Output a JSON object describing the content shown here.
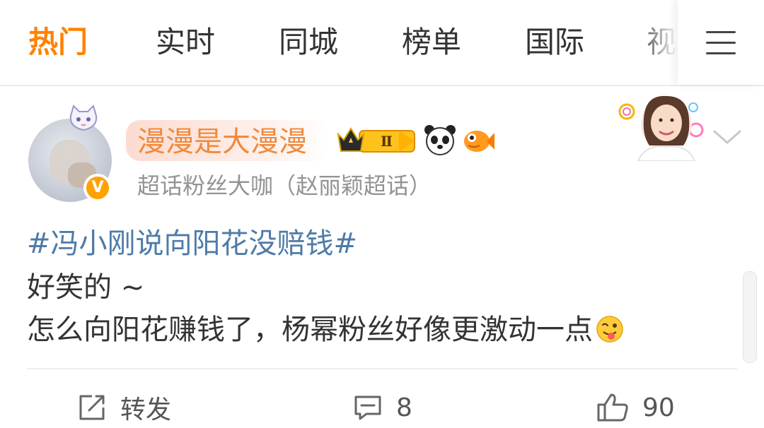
{
  "tabs": [
    {
      "label": "热门",
      "active": true
    },
    {
      "label": "实时",
      "active": false
    },
    {
      "label": "同城",
      "active": false
    },
    {
      "label": "榜单",
      "active": false
    },
    {
      "label": "国际",
      "active": false
    },
    {
      "label": "视",
      "active": false
    }
  ],
  "menu": {
    "icon": "hamburger-menu-icon"
  },
  "post": {
    "author": {
      "name": "漫漫是大漫漫",
      "title": "超话粉丝大咖（赵丽颖超话）",
      "verified_mark": "V",
      "badges": [
        "crown-level-badge",
        "panda-badge",
        "goldfish-badge"
      ]
    },
    "hashtag": "#冯小刚说向阳花没赔钱#",
    "lines": [
      "好笑的 ~",
      "怎么向阳花赚钱了，杨幂粉丝好像更激动一点"
    ],
    "level_badge_text": "Ⅱ"
  },
  "actions": {
    "repost": {
      "label": "转发",
      "icon": "share-icon"
    },
    "comment": {
      "count": "8",
      "icon": "comment-icon"
    },
    "like": {
      "count": "90",
      "icon": "thumbs-up-icon"
    }
  },
  "colors": {
    "accent": "#ff8200",
    "hashtag": "#4e7ba8",
    "muted": "#939393"
  }
}
